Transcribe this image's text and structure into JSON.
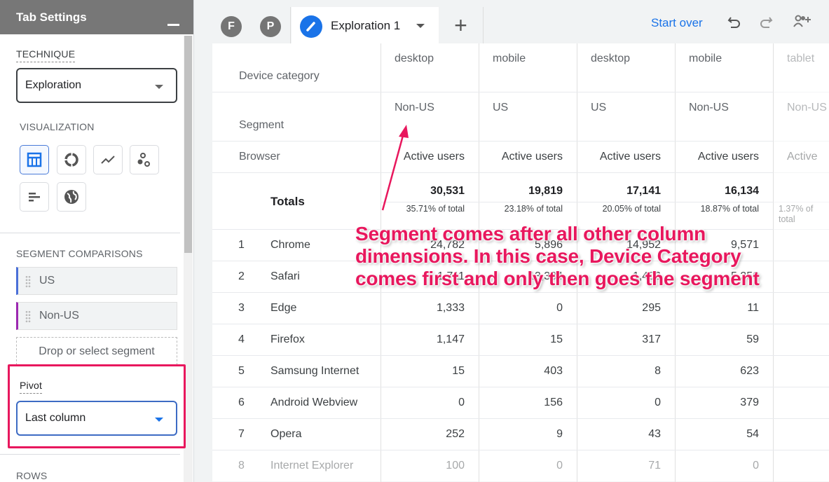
{
  "sidebar": {
    "title": "Tab Settings",
    "technique_label": "TECHNIQUE",
    "technique_value": "Exploration",
    "visualization_label": "VISUALIZATION",
    "visualizations": [
      "table-icon",
      "donut-icon",
      "line-chart-icon",
      "scatter-icon",
      "bar-chart-icon",
      "globe-icon"
    ],
    "segment_comparisons_label": "SEGMENT COMPARISONS",
    "segments": [
      {
        "name": "US",
        "color": "#4a6fd8"
      },
      {
        "name": "Non-US",
        "color": "#9c27b0"
      }
    ],
    "drop_segment": "Drop or select segment",
    "pivot_label": "Pivot",
    "pivot_value": "Last column",
    "rows_label": "ROWS"
  },
  "tabs": {
    "avatars": [
      "F",
      "P"
    ],
    "active": "Exploration 1",
    "start_over": "Start over"
  },
  "table": {
    "row_headers": {
      "device": "Device category",
      "segment": "Segment",
      "browser": "Browser",
      "totals": "Totals"
    },
    "columns": [
      {
        "device": "desktop",
        "segment": "Non-US",
        "metric": "Active users",
        "total": "30,531",
        "pct": "35.71% of total"
      },
      {
        "device": "mobile",
        "segment": "US",
        "metric": "Active users",
        "total": "19,819",
        "pct": "23.18% of total"
      },
      {
        "device": "desktop",
        "segment": "US",
        "metric": "Active users",
        "total": "17,141",
        "pct": "20.05% of total"
      },
      {
        "device": "mobile",
        "segment": "Non-US",
        "metric": "Active users",
        "total": "16,134",
        "pct": "18.87% of total"
      },
      {
        "device": "tablet",
        "segment": "Non-US",
        "metric": "Active",
        "total": "",
        "pct": "1.37% of total"
      }
    ],
    "rows": [
      {
        "n": "1",
        "browser": "Chrome",
        "values": [
          "24,782",
          "5,896",
          "14,952",
          "9,571",
          ""
        ]
      },
      {
        "n": "2",
        "browser": "Safari",
        "values": [
          "1,711",
          "13,384",
          "1,406",
          "5,250",
          ""
        ]
      },
      {
        "n": "3",
        "browser": "Edge",
        "values": [
          "1,333",
          "0",
          "295",
          "11",
          ""
        ]
      },
      {
        "n": "4",
        "browser": "Firefox",
        "values": [
          "1,147",
          "15",
          "317",
          "59",
          ""
        ]
      },
      {
        "n": "5",
        "browser": "Samsung Internet",
        "values": [
          "15",
          "403",
          "8",
          "623",
          ""
        ]
      },
      {
        "n": "6",
        "browser": "Android Webview",
        "values": [
          "0",
          "156",
          "0",
          "379",
          ""
        ]
      },
      {
        "n": "7",
        "browser": "Opera",
        "values": [
          "252",
          "9",
          "43",
          "54",
          ""
        ]
      },
      {
        "n": "8",
        "browser": "Internet Explorer",
        "values": [
          "100",
          "0",
          "71",
          "0",
          ""
        ]
      }
    ]
  },
  "annotation": {
    "lines": [
      "Segment comes after all other column",
      "dimensions. In this case, Device Category",
      "comes first and only then goes the segment"
    ],
    "color": "#e8175d"
  }
}
